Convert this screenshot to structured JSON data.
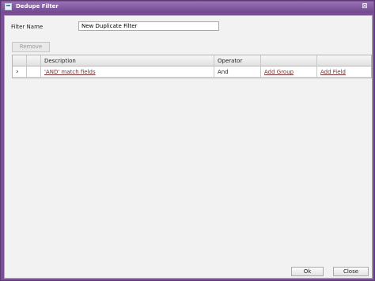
{
  "window": {
    "title": "Dedupe Filter",
    "close_icon": "⊠"
  },
  "form": {
    "filter_name_label": "Filter Name",
    "filter_name_value": "New Duplicate Filter"
  },
  "toolbar": {
    "remove_label": "Remove"
  },
  "grid": {
    "headers": {
      "description": "Description",
      "operator": "Operator"
    },
    "rows": [
      {
        "expand_icon": "›",
        "description": "'AND' match fields",
        "operator": "And",
        "add_group": "Add Group",
        "add_field": "Add Field"
      }
    ]
  },
  "footer": {
    "ok_label": "Ok",
    "close_label": "Close"
  }
}
